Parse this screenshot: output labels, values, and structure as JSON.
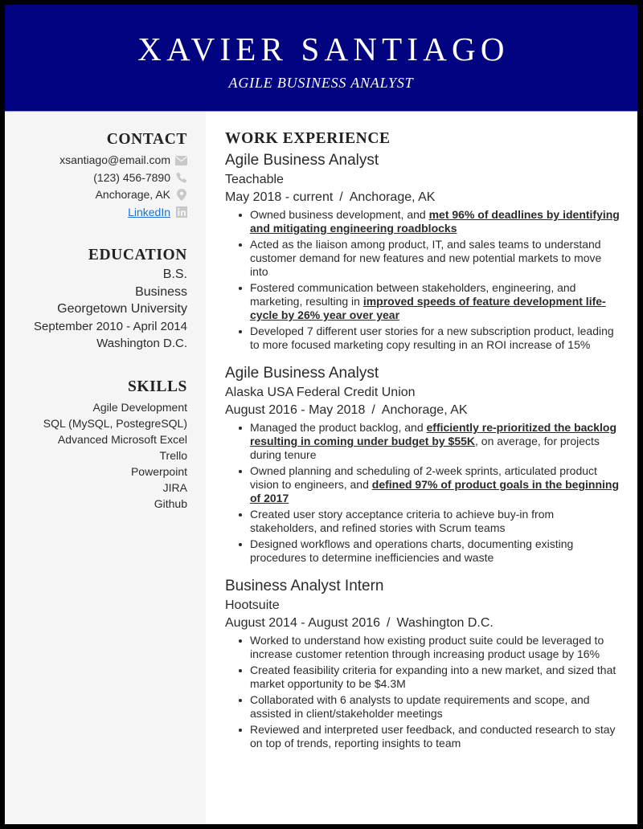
{
  "header": {
    "name": "XAVIER SANTIAGO",
    "title": "AGILE BUSINESS ANALYST"
  },
  "colors": {
    "header_bg": "#020381",
    "sidebar_bg": "#f5f5f5",
    "link": "#1e6fd9",
    "icon": "#c8c8c8"
  },
  "sidebar": {
    "contact": {
      "heading": "CONTACT",
      "items": [
        {
          "text": "xsantiago@email.com",
          "icon": "envelope-icon"
        },
        {
          "text": "(123) 456-7890",
          "icon": "phone-icon"
        },
        {
          "text": "Anchorage, AK",
          "icon": "map-pin-icon"
        },
        {
          "text": "LinkedIn",
          "icon": "linkedin-icon",
          "is_link": true
        }
      ]
    },
    "education": {
      "heading": "EDUCATION",
      "degree": "B.S.",
      "major": "Business",
      "school": "Georgetown University",
      "dates": "September 2010 - April 2014",
      "location": "Washington D.C."
    },
    "skills": {
      "heading": "SKILLS",
      "items": [
        "Agile Development",
        "SQL (MySQL, PostegreSQL)",
        "Advanced Microsoft Excel",
        "Trello",
        "Powerpoint",
        "JIRA",
        "Github"
      ]
    }
  },
  "main": {
    "heading": "WORK EXPERIENCE",
    "separator": "/",
    "jobs": [
      {
        "title": "Agile Business Analyst",
        "company": "Teachable",
        "dates": "May 2018 - current",
        "location": "Anchorage, AK",
        "bullets": [
          [
            {
              "t": "Owned business development, and "
            },
            {
              "t": "met 96% of deadlines by identifying and mitigating engineering roadblocks",
              "hl": true
            }
          ],
          [
            {
              "t": "Acted as the liaison among product, IT, and sales teams to understand customer demand for new features and new potential markets to move into"
            }
          ],
          [
            {
              "t": "Fostered communication between stakeholders, engineering, and marketing, resulting in "
            },
            {
              "t": "improved speeds of feature development life-cycle by 26% year over year",
              "hl": true
            }
          ],
          [
            {
              "t": "Developed 7 different user stories for a new subscription product, leading to more focused marketing copy resulting in an ROI increase of 15%"
            }
          ]
        ]
      },
      {
        "title": "Agile Business Analyst",
        "company": "Alaska USA Federal Credit Union",
        "dates": "August 2016 - May 2018",
        "location": "Anchorage, AK",
        "bullets": [
          [
            {
              "t": "Managed the product backlog, and "
            },
            {
              "t": "efficiently re-prioritized the backlog resulting in coming under budget by $55K",
              "hl": true
            },
            {
              "t": ", on average, for projects during tenure"
            }
          ],
          [
            {
              "t": "Owned planning and scheduling of 2-week sprints, articulated product vision to engineers, and "
            },
            {
              "t": "defined 97% of product goals in the beginning of 2017",
              "hl": true
            }
          ],
          [
            {
              "t": "Created user story acceptance criteria to achieve buy-in from stakeholders, and refined stories with Scrum teams"
            }
          ],
          [
            {
              "t": "Designed workflows and operations charts, documenting existing procedures to determine inefficiencies and waste"
            }
          ]
        ]
      },
      {
        "title": "Business Analyst Intern",
        "company": "Hootsuite",
        "dates": "August 2014 - August 2016",
        "location": "Washington D.C.",
        "bullets": [
          [
            {
              "t": "Worked to understand how existing product suite could be leveraged to increase customer retention through increasing product usage by 16%"
            }
          ],
          [
            {
              "t": "Created feasibility criteria for expanding into a new market, and sized that market opportunity to be $4.3M"
            }
          ],
          [
            {
              "t": "Collaborated with 6 analysts to update requirements and scope, and assisted in client/stakeholder meetings"
            }
          ],
          [
            {
              "t": "Reviewed and interpreted user feedback, and conducted research to stay on top of trends, reporting insights to team"
            }
          ]
        ]
      }
    ]
  }
}
